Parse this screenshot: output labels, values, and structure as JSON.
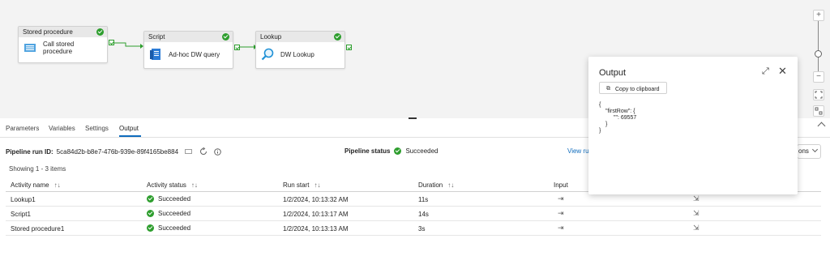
{
  "activities": [
    {
      "id": "stored-procedure",
      "header": "Stored procedure",
      "label": "Call stored procedure"
    },
    {
      "id": "script",
      "header": "Script",
      "label": "Ad-hoc DW query"
    },
    {
      "id": "lookup",
      "header": "Lookup",
      "label": "DW Lookup"
    }
  ],
  "zoom": {
    "plus": "+",
    "minus": "−"
  },
  "tabs": [
    "Parameters",
    "Variables",
    "Settings",
    "Output"
  ],
  "active_tab": "Output",
  "run": {
    "id_label": "Pipeline run ID:",
    "id_value": "5ca84d2b-b8e7-476b-939e-89f4165be884",
    "status_label": "Pipeline status",
    "status_value": "Succeeded",
    "view_run": "View ru",
    "options": "ons",
    "showing": "Showing 1 - 3 items"
  },
  "table": {
    "columns": [
      "Activity name",
      "Activity status",
      "Run start",
      "Duration",
      "Input"
    ],
    "rows": [
      {
        "name": "Lookup1",
        "status": "Succeeded",
        "start": "1/2/2024, 10:13:32 AM",
        "duration": "11s"
      },
      {
        "name": "Script1",
        "status": "Succeeded",
        "start": "1/2/2024, 10:13:17 AM",
        "duration": "14s"
      },
      {
        "name": "Stored procedure1",
        "status": "Succeeded",
        "start": "1/2/2024, 10:13:13 AM",
        "duration": "3s"
      }
    ]
  },
  "output_panel": {
    "title": "Output",
    "copy_label": "Copy to clipboard",
    "json_lines": [
      "{",
      "    \"firstRow\": {",
      "        \"\": 69557",
      "    }",
      "}"
    ]
  },
  "colors": {
    "accent": "#0f6cbd",
    "success": "#2e9e2e"
  }
}
